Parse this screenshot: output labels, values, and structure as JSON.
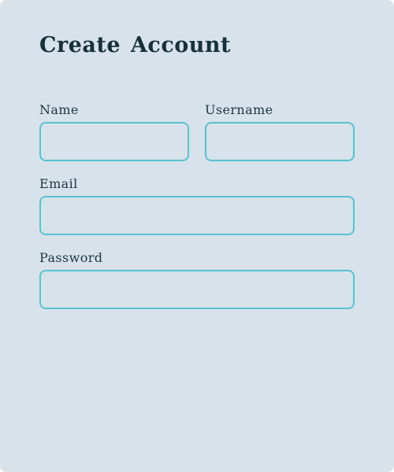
{
  "form": {
    "title": "Create Account",
    "fields": {
      "name": {
        "label": "Name",
        "value": "",
        "placeholder": ""
      },
      "username": {
        "label": "Username",
        "value": "",
        "placeholder": ""
      },
      "email": {
        "label": "Email",
        "value": "",
        "placeholder": ""
      },
      "password": {
        "label": "Password",
        "value": "",
        "placeholder": ""
      }
    }
  },
  "colors": {
    "card_background": "#d8e2ea",
    "title_text": "#17313b",
    "input_border": "#55c3d3"
  }
}
